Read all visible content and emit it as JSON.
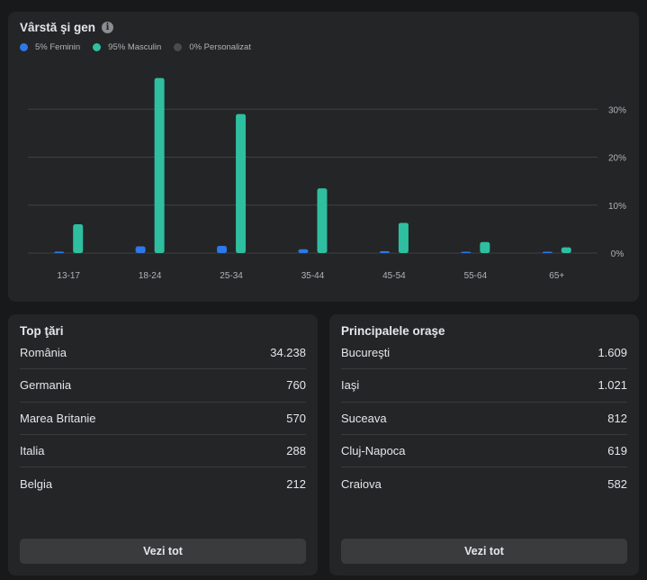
{
  "age_gender": {
    "title": "Vârstă şi gen",
    "legend": [
      {
        "label": "5% Feminin",
        "color": "#2d78ea"
      },
      {
        "label": "95% Masculin",
        "color": "#2ebfa0"
      },
      {
        "label": "0% Personalizat",
        "color": "#4a4b4d"
      }
    ]
  },
  "chart_data": {
    "type": "bar",
    "categories": [
      "13-17",
      "18-24",
      "25-34",
      "35-44",
      "45-54",
      "55-64",
      "65+"
    ],
    "series": [
      {
        "name": "Feminin",
        "color": "#2d78ea",
        "values": [
          0.3,
          1.4,
          1.5,
          0.8,
          0.4,
          0.15,
          0.1
        ]
      },
      {
        "name": "Masculin",
        "color": "#2ebfa0",
        "values": [
          6.0,
          36.5,
          29.0,
          13.5,
          6.3,
          2.3,
          1.2
        ]
      },
      {
        "name": "Personalizat",
        "color": "#4a4b4d",
        "values": [
          0,
          0,
          0,
          0,
          0,
          0,
          0
        ]
      }
    ],
    "yticks": [
      0,
      10,
      20,
      30
    ],
    "ytick_labels": [
      "0%",
      "10%",
      "20%",
      "30%"
    ],
    "ylim": [
      0,
      40
    ],
    "grid": true
  },
  "countries": {
    "title": "Top ţări",
    "rows": [
      {
        "name": "România",
        "value": "34.238"
      },
      {
        "name": "Germania",
        "value": "760"
      },
      {
        "name": "Marea Britanie",
        "value": "570"
      },
      {
        "name": "Italia",
        "value": "288"
      },
      {
        "name": "Belgia",
        "value": "212"
      }
    ],
    "button": "Vezi tot"
  },
  "cities": {
    "title": "Principalele oraşe",
    "rows": [
      {
        "name": "Bucureşti",
        "value": "1.609"
      },
      {
        "name": "Iaşi",
        "value": "1.021"
      },
      {
        "name": "Suceava",
        "value": "812"
      },
      {
        "name": "Cluj-Napoca",
        "value": "619"
      },
      {
        "name": "Craiova",
        "value": "582"
      }
    ],
    "button": "Vezi tot"
  }
}
